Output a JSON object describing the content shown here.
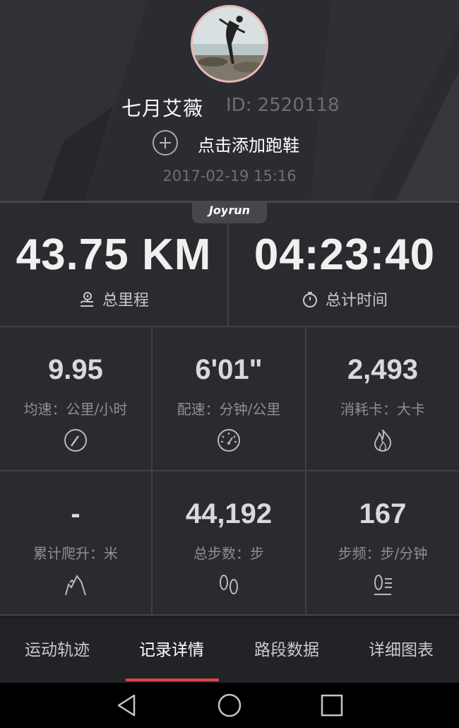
{
  "profile": {
    "username": "七月艾薇",
    "user_id": "ID: 2520118",
    "add_shoe_label": "点击添加跑鞋",
    "datetime": "2017-02-19 15:16"
  },
  "brand": "Joyrun",
  "stats": {
    "distance": {
      "value": "43.75 KM",
      "label": "总里程",
      "icon": "map-pin-icon"
    },
    "duration": {
      "value": "04:23:40",
      "label": "总计时间",
      "icon": "stopwatch-icon"
    },
    "avg_speed": {
      "value": "9.95",
      "label": "均速：公里/小时",
      "icon": "speedometer-icon"
    },
    "pace": {
      "value": "6'01\"",
      "label": "配速：分钟/公里",
      "icon": "gauge-icon"
    },
    "calories": {
      "value": "2,493",
      "label": "消耗卡：大卡",
      "icon": "flame-icon"
    },
    "elevation": {
      "value": "-",
      "label": "累计爬升：米",
      "icon": "mountain-icon"
    },
    "steps": {
      "value": "44,192",
      "label": "总步数：步",
      "icon": "footprints-icon"
    },
    "cadence": {
      "value": "167",
      "label": "步频：步/分钟",
      "icon": "footsteps-rate-icon"
    }
  },
  "tabs": [
    {
      "label": "运动轨迹",
      "active": false
    },
    {
      "label": "记录详情",
      "active": true
    },
    {
      "label": "路段数据",
      "active": false
    },
    {
      "label": "详细图表",
      "active": false
    }
  ],
  "colors": {
    "background": "#2a2b2f",
    "accent": "#e0434a",
    "avatar_border": "#e7b8b6"
  }
}
